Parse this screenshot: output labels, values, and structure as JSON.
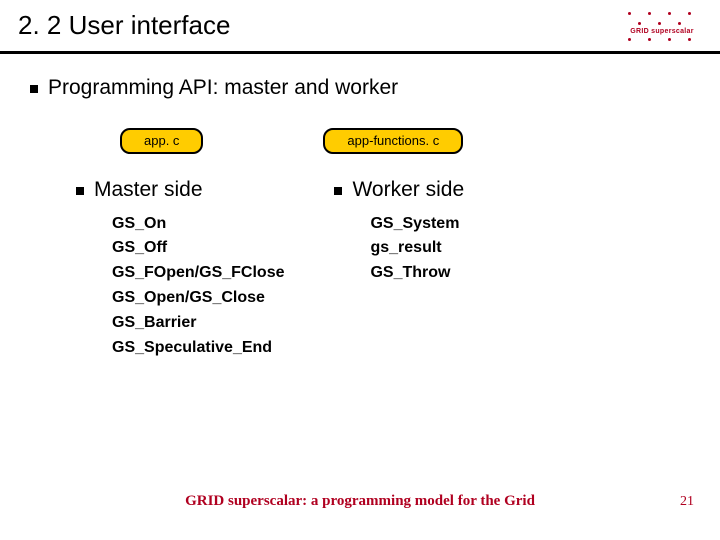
{
  "header": {
    "title": "2. 2 User interface",
    "logo_text": "GRID superscalar"
  },
  "main_bullet": "Programming API: master and worker",
  "master": {
    "file": "app. c",
    "label": "Master side",
    "functions": [
      "GS_On",
      "GS_Off",
      "GS_FOpen/GS_FClose",
      "GS_Open/GS_Close",
      "GS_Barrier",
      "GS_Speculative_End"
    ]
  },
  "worker": {
    "file": "app-functions. c",
    "label": "Worker side",
    "functions": [
      "GS_System",
      "gs_result",
      "GS_Throw"
    ]
  },
  "footer": "GRID superscalar: a programming model for the Grid",
  "page_number": "21"
}
